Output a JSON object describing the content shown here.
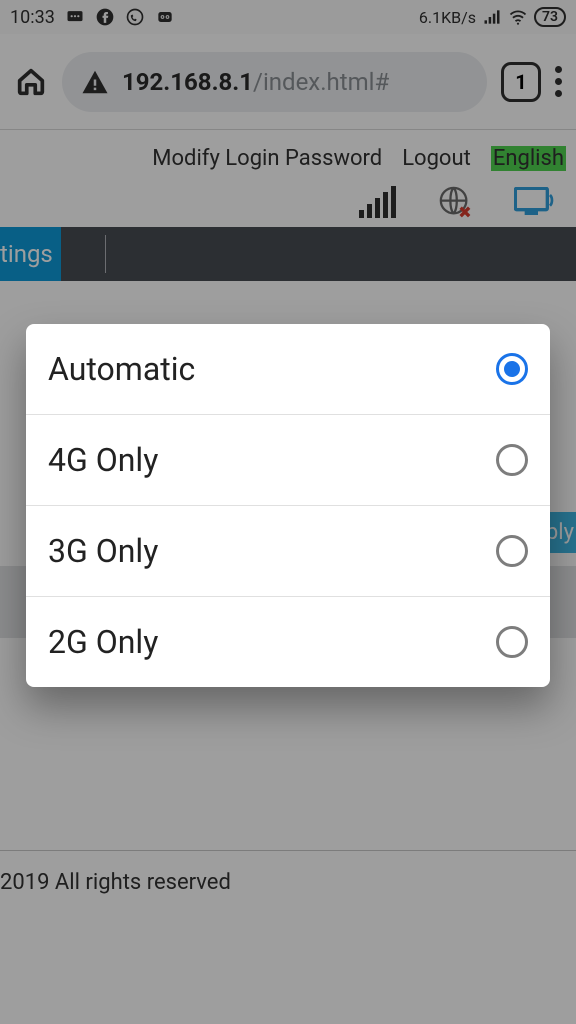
{
  "status": {
    "time": "10:33",
    "speed": "6.1KB/s",
    "battery": "73"
  },
  "browser": {
    "url_bold": "192.168.8.1",
    "url_rest": "/index.html#",
    "tab_count": "1"
  },
  "page": {
    "links": {
      "modify": "Modify Login Password",
      "logout": "Logout",
      "lang": "English"
    },
    "tab_label": "tings",
    "apply": "ply",
    "footer": "2019 All rights reserved"
  },
  "modal": {
    "options": [
      {
        "label": "Automatic",
        "selected": true
      },
      {
        "label": "4G Only",
        "selected": false
      },
      {
        "label": "3G Only",
        "selected": false
      },
      {
        "label": "2G Only",
        "selected": false
      }
    ]
  }
}
